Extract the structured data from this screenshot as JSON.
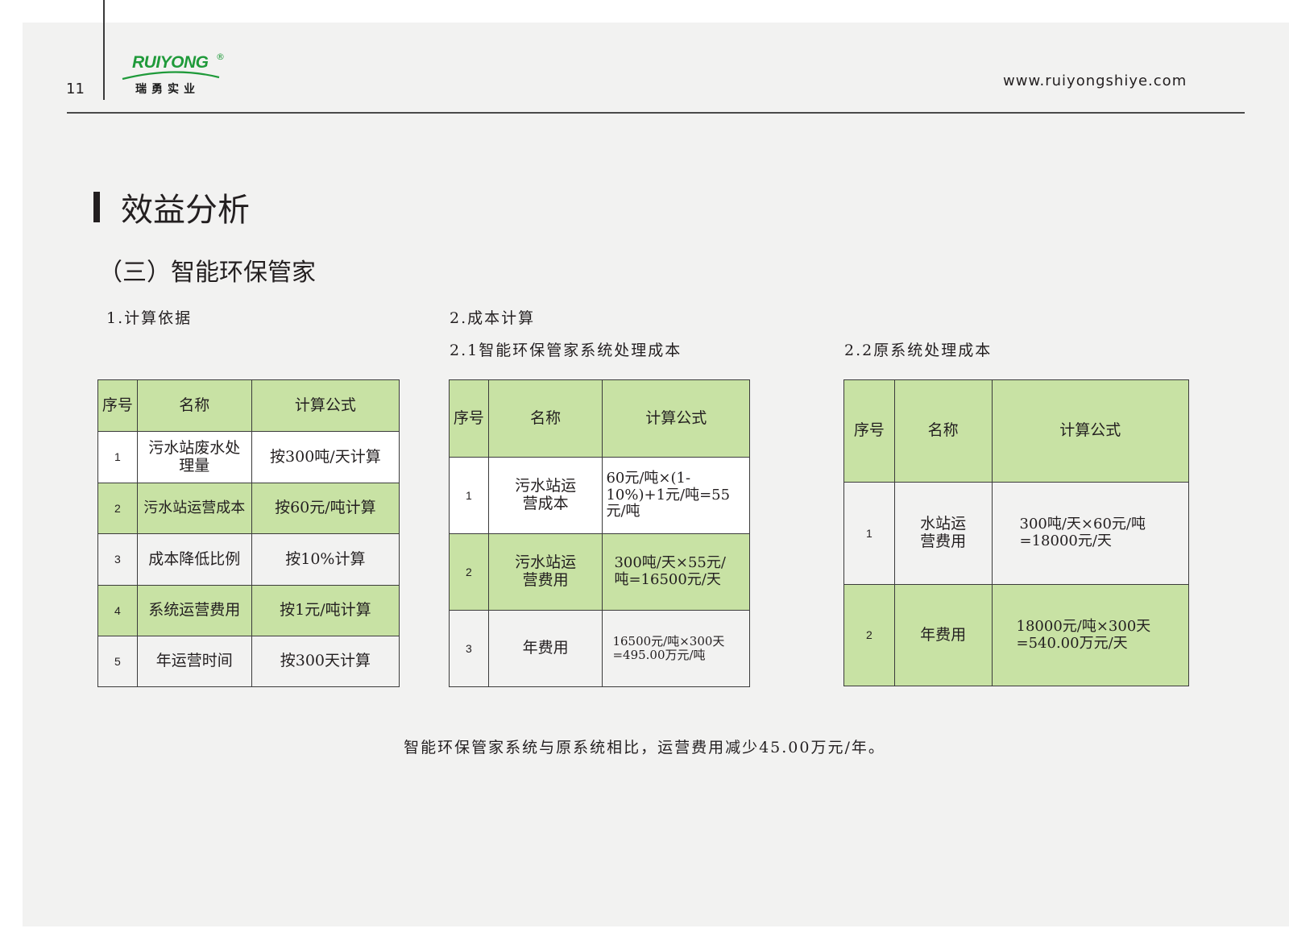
{
  "header": {
    "page_number": "11",
    "logo_en": "RUIYONG",
    "logo_reg": "®",
    "logo_cn": "瑞勇实业",
    "website": "www.ruiyongshiye.com"
  },
  "title": "效益分析",
  "subtitle": "（三）智能环保管家",
  "section1": {
    "label": "1.计算依据",
    "headers": [
      "序号",
      "名称",
      "计算公式"
    ],
    "rows": [
      {
        "no": "1",
        "name": "污水站废水处理量",
        "formula": "按300吨/天计算"
      },
      {
        "no": "2",
        "name": "污水站运营成本",
        "formula": "按60元/吨计算"
      },
      {
        "no": "3",
        "name": "成本降低比例",
        "formula": "按10%计算"
      },
      {
        "no": "4",
        "name": "系统运营费用",
        "formula": "按1元/吨计算"
      },
      {
        "no": "5",
        "name": "年运营时间",
        "formula": "按300天计算"
      }
    ]
  },
  "section2": {
    "label": "2.成本计算",
    "sub1": {
      "label": "2.1智能环保管家系统处理成本",
      "headers": [
        "序号",
        "名称",
        "计算公式"
      ],
      "rows": [
        {
          "no": "1",
          "name": "污水站运营成本",
          "formula": "60元/吨×(1-10%)+1元/吨=55元/吨"
        },
        {
          "no": "2",
          "name": "污水站运营费用",
          "formula": "300吨/天×55元/吨=16500元/天"
        },
        {
          "no": "3",
          "name": "年费用",
          "formula": "16500元/吨×300天=495.00万元/吨"
        }
      ]
    },
    "sub2": {
      "label": "2.2原系统处理成本",
      "headers": [
        "序号",
        "名称",
        "计算公式"
      ],
      "rows": [
        {
          "no": "1",
          "name": "水站运营费用",
          "formula": "300吨/天×60元/吨=18000元/天"
        },
        {
          "no": "2",
          "name": "年费用",
          "formula": "18000元/吨×300天=540.00万元/天"
        }
      ]
    }
  },
  "footer": "智能环保管家系统与原系统相比，运营费用减少45.00万元/年。",
  "colors": {
    "green_cell": "#c8e2a4",
    "logo_green": "#1f9a3a",
    "page_bg": "#f2f2f1"
  }
}
